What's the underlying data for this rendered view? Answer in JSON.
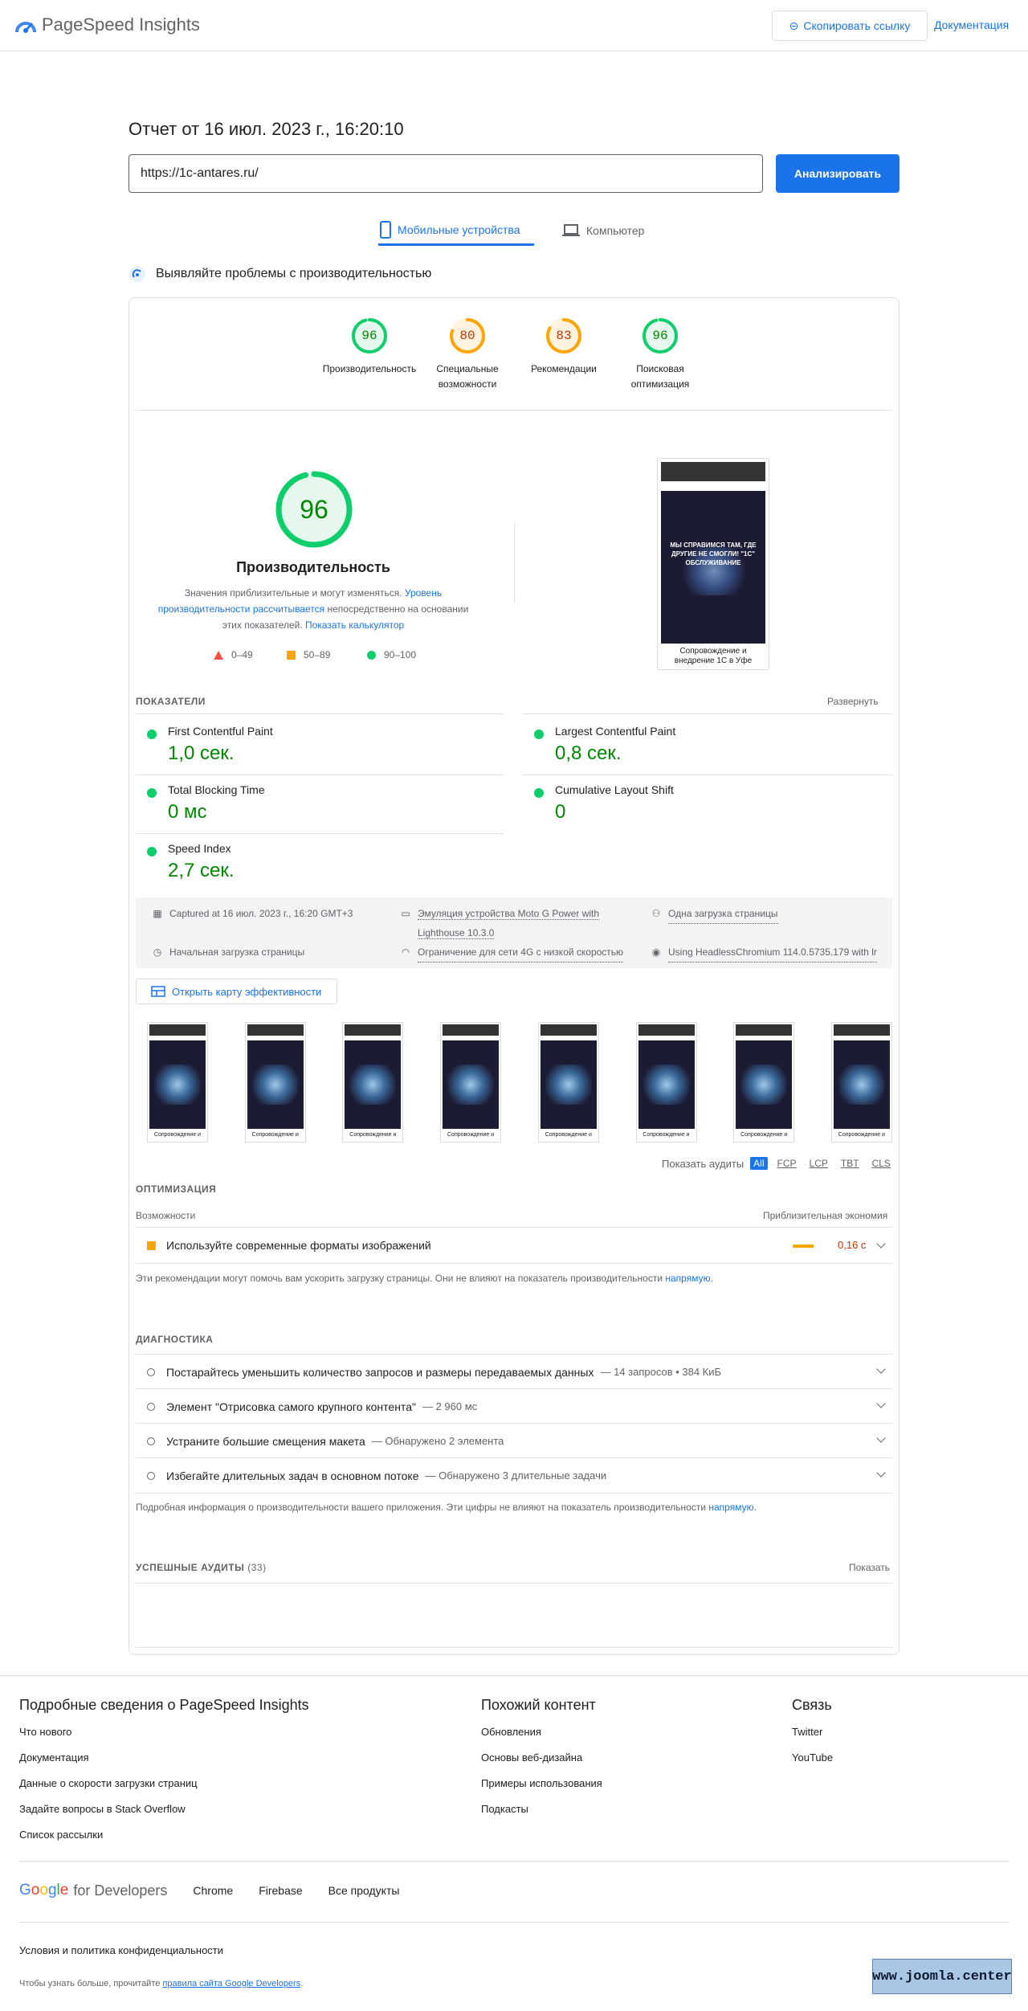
{
  "header": {
    "app_title": "PageSpeed Insights",
    "copy_link_label": "Скопировать ссылку",
    "docs_label": "Документация"
  },
  "report": {
    "title": "Отчет от 16 июл. 2023 г., 16:20:10",
    "url_value": "https://1c-antares.ru/",
    "analyze_label": "Анализировать"
  },
  "tabs": [
    {
      "label": "Мобильные устройства",
      "active": true
    },
    {
      "label": "Компьютер",
      "active": false
    }
  ],
  "section": {
    "heading": "Выявляйте проблемы с производительностью"
  },
  "gauges": [
    {
      "score": "96",
      "label1": "Производительность",
      "label2": "",
      "status": "pass"
    },
    {
      "score": "80",
      "label1": "Специальные",
      "label2": "возможности",
      "status": "average"
    },
    {
      "score": "83",
      "label1": "Рекомендации",
      "label2": "",
      "status": "average"
    },
    {
      "score": "96",
      "label1": "Поисковая",
      "label2": "оптимизация",
      "status": "pass"
    }
  ],
  "performance": {
    "score": "96",
    "title": "Производительность",
    "desc_part1": "Значения приблизительные и могут изменяться. ",
    "desc_link1": "Уровень производительности рассчитывается",
    "desc_part2": " непосредственно на основании этих показателей. ",
    "desc_link2": "Показать калькулятор",
    "legend": [
      {
        "range": "0–49",
        "shape": "triangle",
        "color": "#ff4e42"
      },
      {
        "range": "50–89",
        "shape": "square",
        "color": "#ffa400"
      },
      {
        "range": "90–100",
        "shape": "circle",
        "color": "#0cce6b"
      }
    ]
  },
  "screenshot": {
    "hero_text": "МЫ СПРАВИМСЯ ТАМ, ГДЕ ДРУГИЕ НЕ СМОГЛИ! \"1С\" ОБСЛУЖИВАНИЕ",
    "caption": "Сопровождение и внедрение 1С в Уфе"
  },
  "metrics": {
    "label": "ПОКАЗАТЕЛИ",
    "expand_label": "Развернуть",
    "items": [
      {
        "name": "First Contentful Paint",
        "value": "1,0 сек."
      },
      {
        "name": "Largest Contentful Paint",
        "value": "0,8 сек."
      },
      {
        "name": "Total Blocking Time",
        "value": "0 мс"
      },
      {
        "name": "Cumulative Layout Shift",
        "value": "0"
      },
      {
        "name": "Speed Index",
        "value": "2,7 сек."
      }
    ]
  },
  "info": {
    "captured": "Captured at 16 июл. 2023 г., 16:20 GMT+3",
    "emulation": "Эмуляция устройства Moto G Power with",
    "emulation2": "Lighthouse 10.3.0",
    "single_load": "Одна загрузка страницы",
    "initial_load": "Начальная загрузка страницы",
    "network": "Ограничение для сети 4G с низкой скоростью",
    "browser": "Using HeadlessChromium 114.0.5735.179 with lr"
  },
  "treemap": {
    "label": "Открыть карту эффективности"
  },
  "filmstrip": {
    "caption": "Сопровождение и",
    "frames": 8
  },
  "audit_filter": {
    "label": "Показать аудиты",
    "chips": [
      "All",
      "FCP",
      "LCP",
      "TBT",
      "CLS"
    ]
  },
  "opportunities": {
    "title": "ОПТИМИЗАЦИЯ",
    "col_left": "Возможности",
    "col_right": "Приблизительная экономия",
    "items": [
      {
        "text": "Используйте современные форматы изображений",
        "savings": "0,16 с"
      }
    ],
    "note_text": "Эти рекомендации могут помочь вам ускорить загрузку страницы. Они не влияют на показатель производительности ",
    "note_link": "напрямую",
    "note_end": "."
  },
  "diagnostics": {
    "title": "ДИАГНОСТИКА",
    "items": [
      {
        "text": "Постарайтесь уменьшить количество запросов и размеры передаваемых данных",
        "sub": "— 14 запросов • 384 КиБ"
      },
      {
        "text": "Элемент \"Отрисовка самого крупного контента\"",
        "sub": "— 2 960 мс"
      },
      {
        "text": "Устраните большие смещения макета",
        "sub": "— Обнаружено 2 элемента"
      },
      {
        "text": "Избегайте длительных задач в основном потоке",
        "sub": "— Обнаружено 3 длительные задачи"
      }
    ],
    "note_text": "Подробная информация о производительности вашего приложения. Эти цифры не влияют на показатель производительности ",
    "note_link": "напрямую",
    "note_end": "."
  },
  "passed": {
    "title": "УСПЕШНЫЕ АУДИТЫ",
    "count": "(33)",
    "show_label": "Показать"
  },
  "footer": {
    "col1_title": "Подробные сведения о PageSpeed Insights",
    "col1_links": [
      "Что нового",
      "Документация",
      "Данные о скорости загрузки страниц",
      "Задайте вопросы в Stack Overflow",
      "Список рассылки"
    ],
    "col2_title": "Похожий контент",
    "col2_links": [
      "Обновления",
      "Основы веб-дизайна",
      "Примеры использования",
      "Подкасты"
    ],
    "col3_title": "Связь",
    "col3_links": [
      "Twitter",
      "YouTube"
    ],
    "brand_google": "Google",
    "brand_dev": "for Developers",
    "brand_links": [
      "Chrome",
      "Firebase",
      "Все продукты"
    ],
    "terms": "Условия и политика конфиденциальности",
    "more_text": "Чтобы узнать больше, прочитайте ",
    "more_link": "правила сайта Google Developers",
    "more_end": ".",
    "badge": "www.joomla.center"
  },
  "colors": {
    "accent": "#1a73e8",
    "pass": "#0cce6b",
    "average": "#ffa400",
    "fail": "#ff4e42"
  }
}
